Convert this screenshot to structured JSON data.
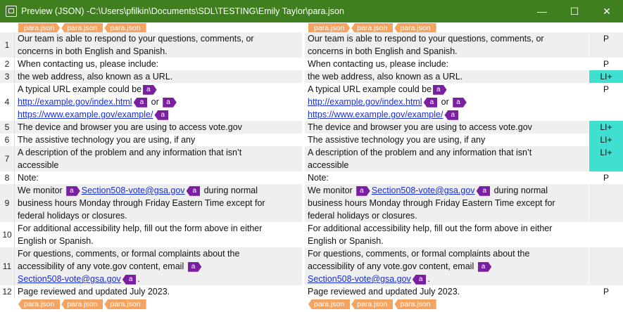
{
  "window": {
    "title": "Preview (JSON) -C:\\Users\\pfilkin\\Documents\\SDL\\TESTING\\Emily Taylor\\para.json",
    "minimize": "—",
    "maximize": "☐",
    "close": "✕"
  },
  "file_tags": {
    "top": [
      "para.json",
      "para.json",
      "para.json"
    ],
    "bottom": [
      "para.json",
      "para.json",
      "para.json"
    ]
  },
  "tag_letter": "a",
  "rows": [
    {
      "num": "1",
      "status": "P",
      "lines": [
        "Our team is able to respond to your questions, comments, or",
        "concerns in both English and Spanish."
      ]
    },
    {
      "num": "2",
      "status": "P",
      "lines": [
        "When contacting us, please include:"
      ]
    },
    {
      "num": "3",
      "status": "LI+",
      "lines": [
        "the web address, also known as a URL."
      ]
    },
    {
      "num": "4",
      "status": "P",
      "l1": "A typical URL example could be",
      "link1": "http://example.gov/index.html",
      "or": "or",
      "link2": "https://www.example.gov/example/"
    },
    {
      "num": "5",
      "status": "LI+",
      "lines": [
        "The device and browser you are using to access vote.gov"
      ]
    },
    {
      "num": "6",
      "status": "LI+",
      "lines": [
        "The assistive technology you are using, if any"
      ]
    },
    {
      "num": "7",
      "status": "LI+",
      "lines": [
        "A description of the problem and any information that isn’t",
        "accessible"
      ]
    },
    {
      "num": "8",
      "status": "P",
      "lines": [
        "Note:"
      ]
    },
    {
      "num": "9",
      "status": "",
      "pre": "We monitor",
      "link": "Section508-vote@gsa.gov",
      "post": "during normal",
      "l2": "business hours Monday through Friday Eastern Time except for",
      "l3": "federal holidays or closures."
    },
    {
      "num": "10",
      "status": "",
      "lines": [
        "For additional accessibility help, fill out the form above in either",
        "English or Spanish."
      ]
    },
    {
      "num": "11",
      "status": "",
      "l1": "For questions, comments, or formal complaints about the",
      "l2": "accessibility of any vote.gov content, email",
      "link": "Section508-vote@gsa.gov",
      "end": "."
    },
    {
      "num": "12",
      "status": "P",
      "lines": [
        "Page reviewed and updated July 2023."
      ]
    }
  ]
}
